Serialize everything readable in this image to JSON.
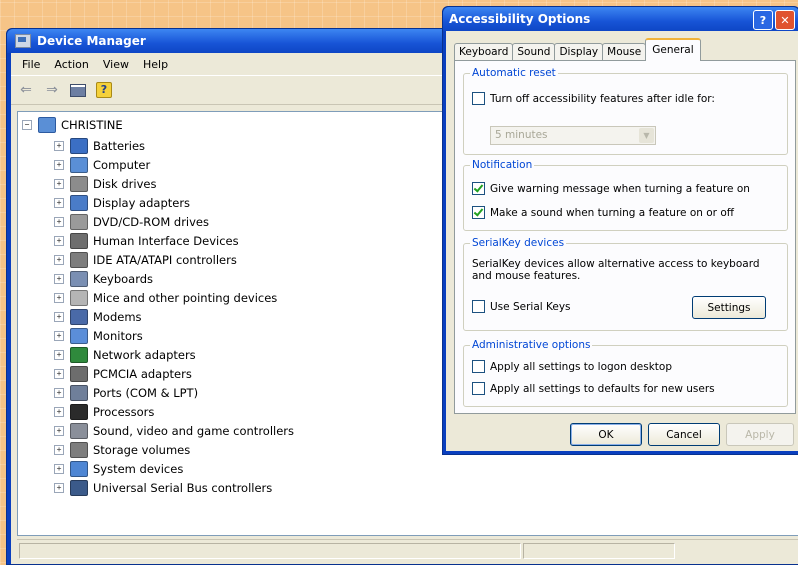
{
  "device_manager": {
    "title": "Device Manager",
    "menu": [
      "File",
      "Action",
      "View",
      "Help"
    ],
    "root": "CHRISTINE",
    "categories": [
      {
        "label": "Batteries",
        "icon": "battery-icon",
        "color": "#3b6fc4"
      },
      {
        "label": "Computer",
        "icon": "computer-icon",
        "color": "#5a8fd6"
      },
      {
        "label": "Disk drives",
        "icon": "disk-drive-icon",
        "color": "#8c8c8c"
      },
      {
        "label": "Display adapters",
        "icon": "display-adapter-icon",
        "color": "#4a7cc8"
      },
      {
        "label": "DVD/CD-ROM drives",
        "icon": "dvd-drive-icon",
        "color": "#9a9a9a"
      },
      {
        "label": "Human Interface Devices",
        "icon": "hid-icon",
        "color": "#6e6e6e"
      },
      {
        "label": "IDE ATA/ATAPI controllers",
        "icon": "ide-controller-icon",
        "color": "#7d7d7d"
      },
      {
        "label": "Keyboards",
        "icon": "keyboard-icon",
        "color": "#7a8fb3"
      },
      {
        "label": "Mice and other pointing devices",
        "icon": "mouse-icon",
        "color": "#b5b5b5"
      },
      {
        "label": "Modems",
        "icon": "modem-icon",
        "color": "#4a6aa8"
      },
      {
        "label": "Monitors",
        "icon": "monitor-icon",
        "color": "#5b8ed9"
      },
      {
        "label": "Network adapters",
        "icon": "network-adapter-icon",
        "color": "#2f8a3c"
      },
      {
        "label": "PCMCIA adapters",
        "icon": "pcmcia-icon",
        "color": "#6d6d6d"
      },
      {
        "label": "Ports (COM & LPT)",
        "icon": "port-icon",
        "color": "#6f7f9a"
      },
      {
        "label": "Processors",
        "icon": "processor-icon",
        "color": "#2b2b2b"
      },
      {
        "label": "Sound, video and game controllers",
        "icon": "sound-icon",
        "color": "#8a8f9a"
      },
      {
        "label": "Storage volumes",
        "icon": "storage-volume-icon",
        "color": "#7e7e7e"
      },
      {
        "label": "System devices",
        "icon": "system-devices-icon",
        "color": "#4e86d4"
      },
      {
        "label": "Universal Serial Bus controllers",
        "icon": "usb-icon",
        "color": "#3b5a8a"
      }
    ]
  },
  "accessibility": {
    "title": "Accessibility Options",
    "tabs": [
      "Keyboard",
      "Sound",
      "Display",
      "Mouse",
      "General"
    ],
    "active_tab": "General",
    "automatic_reset": {
      "label": "Automatic reset",
      "checkbox": "Turn off accessibility features after idle for:",
      "checked": false,
      "select_value": "5 minutes"
    },
    "notification": {
      "label": "Notification",
      "option1": "Give warning message when turning a feature on",
      "option1_checked": true,
      "option2": "Make a sound when turning a feature on or off",
      "option2_checked": true
    },
    "serialkey": {
      "label": "SerialKey devices",
      "description": "SerialKey devices allow alternative access to keyboard and mouse features.",
      "checkbox": "Use Serial Keys",
      "checked": false,
      "settings_button": "Settings"
    },
    "admin": {
      "label": "Administrative options",
      "option1": "Apply all settings to logon desktop",
      "option2": "Apply all settings to defaults for new users"
    },
    "buttons": {
      "ok": "OK",
      "cancel": "Cancel",
      "apply": "Apply"
    }
  }
}
